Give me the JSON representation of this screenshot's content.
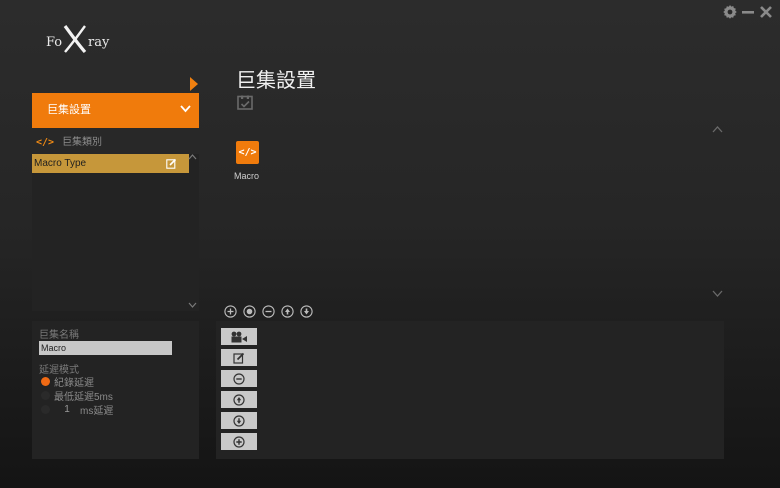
{
  "app": {
    "logo_text": "FoxXray"
  },
  "sidebar": {
    "section_title": "巨集設置",
    "category_label": "巨集類別",
    "category_icon": "code-icon",
    "macros": [
      {
        "label": "Macro Type"
      }
    ]
  },
  "properties": {
    "name_label": "巨集名稱",
    "name_value": "Macro",
    "delay_mode_label": "延遲模式",
    "options": [
      {
        "label": "紀錄延遲",
        "selected": true
      },
      {
        "label": "最低延遲5ms",
        "selected": false
      },
      {
        "label": "ms延遲",
        "value": "1",
        "selected": false
      }
    ]
  },
  "main": {
    "title": "巨集設置",
    "macro_types": [
      {
        "icon": "code-icon",
        "label": "Macro"
      }
    ],
    "mini_toolbar": [
      "add-icon",
      "record-icon",
      "remove-icon",
      "move-up-icon",
      "move-down-icon"
    ],
    "edit_toolbar": [
      "video-record-icon",
      "edit-icon",
      "remove-icon",
      "move-up-icon",
      "move-down-icon",
      "add-icon"
    ]
  },
  "colors": {
    "accent": "#f07b0c",
    "selected_item": "#c6973a",
    "panel": "#232323"
  }
}
